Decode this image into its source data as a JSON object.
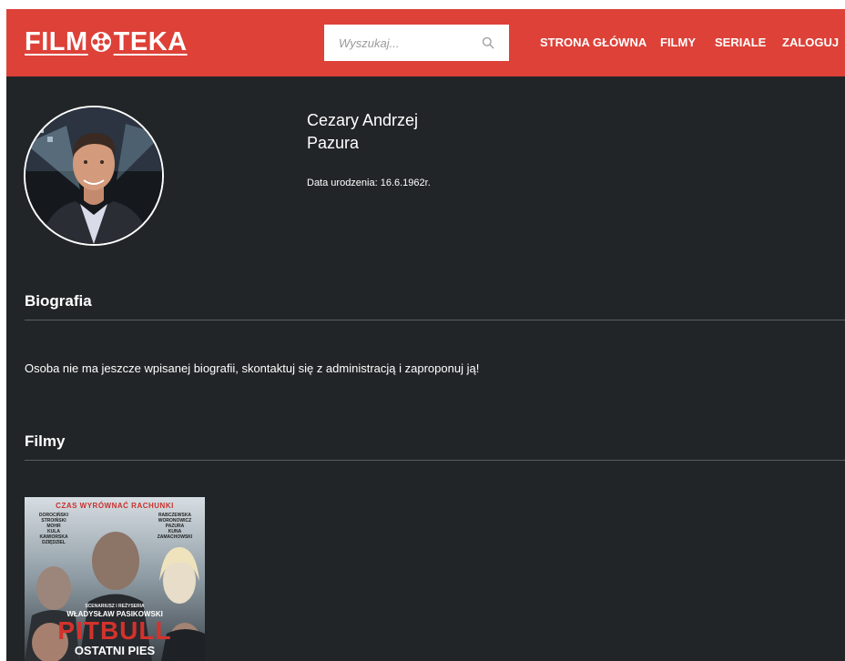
{
  "header": {
    "logo_left": "FILM",
    "logo_right": "TEKA",
    "search_placeholder": "Wyszukaj...",
    "nav": [
      "STRONA GŁÓWNA",
      "FILMY",
      "SERIALE",
      "ZALOGUJ"
    ]
  },
  "person": {
    "first_names": "Cezary Andrzej",
    "last_name": "Pazura",
    "birth": "Data urodzenia: 16.6.1962r."
  },
  "bio": {
    "title": "Biografia",
    "text": "Osoba nie ma jeszcze wpisanej biografii, skontaktuj się z administracją i zaproponuj ją!"
  },
  "films": {
    "title": "Filmy",
    "poster": {
      "tagline": "CZAS WYRÓWNAĆ RACHUNKI",
      "cast_left": [
        "DOROCIŃSKI",
        "STROIŃSKI",
        "MOHR",
        "KULA",
        "KAWIORSKA",
        "DZIĘDZIEL"
      ],
      "cast_right": [
        "RABCZEWSKA",
        "WORONOWICZ",
        "PAZURA",
        "KUNA",
        "ZAMACHOWSKI"
      ],
      "credit": "SCENARIUSZ I REŻYSERIA",
      "director": "WŁADYSŁAW PASIKOWSKI",
      "title_main": "PITBULL",
      "title_sub": "OSTATNI PIES"
    }
  },
  "colors": {
    "header": "#dd4138",
    "background": "#222527"
  }
}
